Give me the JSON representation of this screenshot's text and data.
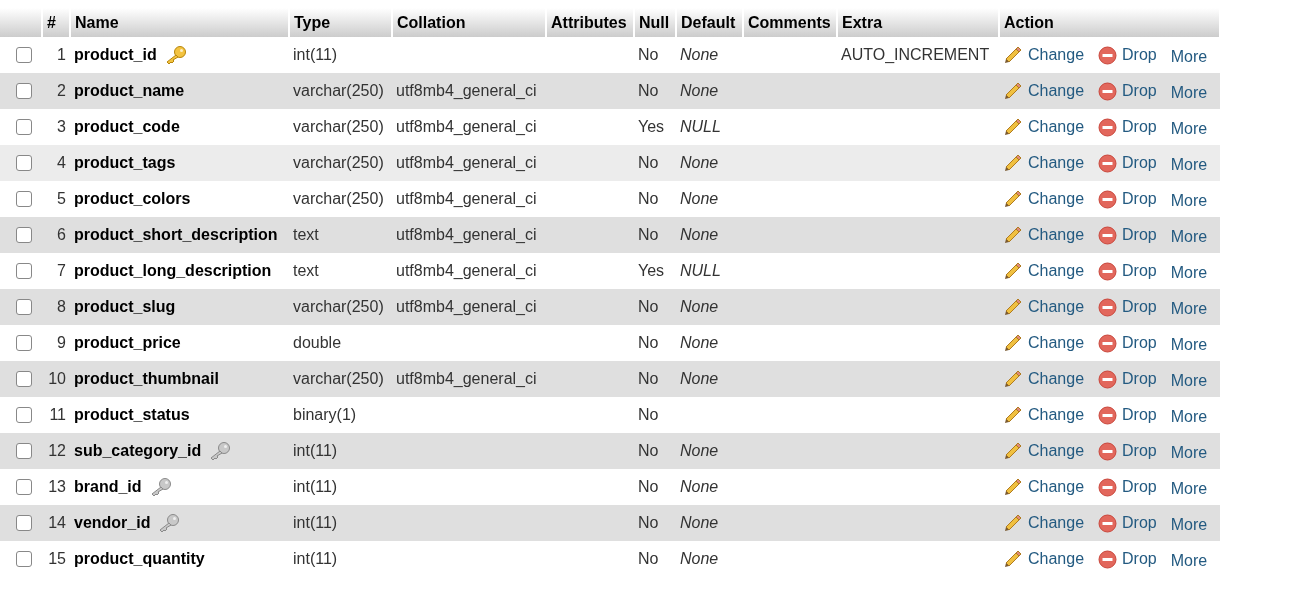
{
  "table": {
    "columns": [
      "#",
      "Name",
      "Type",
      "Collation",
      "Attributes",
      "Null",
      "Default",
      "Comments",
      "Extra",
      "Action"
    ],
    "rows": [
      {
        "checked": false,
        "hovered": false,
        "num": "1",
        "name": "product_id",
        "kind": "primary",
        "type": "int(11)",
        "collation": "",
        "null": "No",
        "default": "None",
        "extra": "AUTO_INCREMENT",
        "actions": [
          "Change",
          "Drop",
          "More"
        ]
      },
      {
        "checked": false,
        "hovered": false,
        "num": "2",
        "name": "product_name",
        "type": "varchar(250)",
        "collation": "utf8mb4_general_ci",
        "null": "No",
        "default": "None",
        "extra": "",
        "actions": [
          "Change",
          "Drop",
          "More"
        ]
      },
      {
        "checked": false,
        "hovered": false,
        "num": "3",
        "name": "product_code",
        "type": "varchar(250)",
        "collation": "utf8mb4_general_ci",
        "null": "Yes",
        "default": "NULL",
        "extra": "",
        "actions": [
          "Change",
          "Drop",
          "More"
        ]
      },
      {
        "checked": false,
        "hovered": true,
        "num": "4",
        "name": "product_tags",
        "type": "varchar(250)",
        "collation": "utf8mb4_general_ci",
        "null": "No",
        "default": "None",
        "extra": "",
        "actions": [
          "Change",
          "Drop",
          "More"
        ]
      },
      {
        "checked": false,
        "hovered": false,
        "num": "5",
        "name": "product_colors",
        "type": "varchar(250)",
        "collation": "utf8mb4_general_ci",
        "null": "No",
        "default": "None",
        "extra": "",
        "actions": [
          "Change",
          "Drop",
          "More"
        ]
      },
      {
        "checked": false,
        "hovered": false,
        "num": "6",
        "name": "product_short_description",
        "type": "text",
        "collation": "utf8mb4_general_ci",
        "null": "No",
        "default": "None",
        "extra": "",
        "actions": [
          "Change",
          "Drop",
          "More"
        ]
      },
      {
        "checked": false,
        "hovered": false,
        "num": "7",
        "name": "product_long_description",
        "type": "text",
        "collation": "utf8mb4_general_ci",
        "null": "Yes",
        "default": "NULL",
        "extra": "",
        "actions": [
          "Change",
          "Drop",
          "More"
        ]
      },
      {
        "checked": false,
        "hovered": false,
        "num": "8",
        "name": "product_slug",
        "type": "varchar(250)",
        "collation": "utf8mb4_general_ci",
        "null": "No",
        "default": "None",
        "extra": "",
        "actions": [
          "Change",
          "Drop",
          "More"
        ]
      },
      {
        "checked": false,
        "hovered": false,
        "num": "9",
        "name": "product_price",
        "type": "double",
        "collation": "",
        "null": "No",
        "default": "None",
        "extra": "",
        "actions": [
          "Change",
          "Drop",
          "More"
        ]
      },
      {
        "checked": false,
        "hovered": false,
        "num": "10",
        "name": "product_thumbnail",
        "type": "varchar(250)",
        "collation": "utf8mb4_general_ci",
        "null": "No",
        "default": "None",
        "extra": "",
        "actions": [
          "Change",
          "Drop",
          "More"
        ]
      },
      {
        "checked": false,
        "hovered": false,
        "num": "11",
        "name": "product_status",
        "type": "binary(1)",
        "collation": "",
        "null": "No",
        "default": "",
        "extra": "",
        "actions": [
          "Change",
          "Drop",
          "More"
        ]
      },
      {
        "checked": false,
        "hovered": false,
        "num": "12",
        "name": "sub_category_id",
        "kind": "index",
        "type": "int(11)",
        "collation": "",
        "null": "No",
        "default": "None",
        "extra": "",
        "actions": [
          "Change",
          "Drop",
          "More"
        ]
      },
      {
        "checked": false,
        "hovered": false,
        "num": "13",
        "name": "brand_id",
        "kind": "index",
        "type": "int(11)",
        "collation": "",
        "null": "No",
        "default": "None",
        "extra": "",
        "actions": [
          "Change",
          "Drop",
          "More"
        ]
      },
      {
        "checked": false,
        "hovered": false,
        "num": "14",
        "name": "vendor_id",
        "kind": "index",
        "type": "int(11)",
        "collation": "",
        "null": "No",
        "default": "None",
        "extra": "",
        "actions": [
          "Change",
          "Drop",
          "More"
        ]
      },
      {
        "checked": false,
        "hovered": false,
        "num": "15",
        "name": "product_quantity",
        "type": "int(11)",
        "collation": "",
        "null": "No",
        "default": "None",
        "extra": "",
        "actions": [
          "Change",
          "Drop",
          "More"
        ]
      }
    ]
  }
}
